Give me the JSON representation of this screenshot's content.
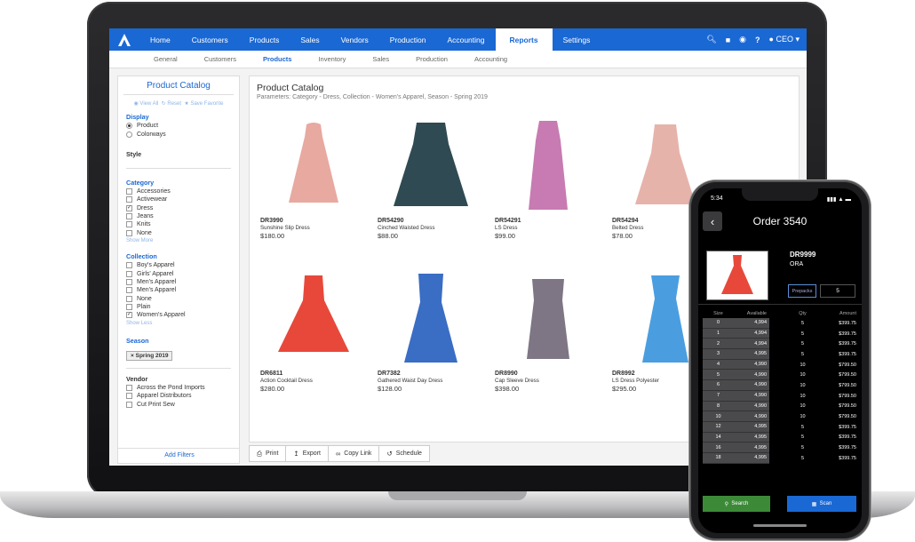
{
  "nav": {
    "items": [
      "Home",
      "Customers",
      "Products",
      "Sales",
      "Vendors",
      "Production",
      "Accounting",
      "Reports",
      "Settings"
    ],
    "active_index": 7,
    "user_label": "CEO"
  },
  "subnav": {
    "items": [
      "General",
      "Customers",
      "Products",
      "Inventory",
      "Sales",
      "Production",
      "Accounting"
    ],
    "active_index": 2
  },
  "sidebar": {
    "title": "Product Catalog",
    "actions": {
      "view_all": "View All",
      "reset": "Reset",
      "save_favorite": "Save Favorite"
    },
    "display": {
      "label": "Display",
      "options": [
        "Product",
        "Colorways"
      ],
      "selected": "Product"
    },
    "style_label": "Style",
    "category": {
      "label": "Category",
      "options": [
        "Accessories",
        "Activewear",
        "Dress",
        "Jeans",
        "Knits",
        "None"
      ],
      "checked": [
        "Dress"
      ],
      "show_link": "Show More"
    },
    "collection": {
      "label": "Collection",
      "options": [
        "Boy's Apparel",
        "Girls' Apparel",
        "Men's Apparel",
        "Men's Apparel",
        "None",
        "Plain",
        "Women's Apparel"
      ],
      "checked": [
        "Women's Apparel"
      ],
      "show_link": "Show Less"
    },
    "season": {
      "label": "Season",
      "tag": "Spring 2019"
    },
    "vendor": {
      "label": "Vendor",
      "options": [
        "Across the Pond Imports",
        "Apparel Distributors",
        "Cut Print Sew"
      ]
    },
    "add_filters": "Add Filters"
  },
  "main": {
    "title": "Product Catalog",
    "params": "Parameters: Category - Dress, Collection - Women's Apparel, Season - Spring 2019",
    "products": [
      {
        "sku": "DR3990",
        "name": "Sunshine Slip Dress",
        "price": "$180.00",
        "color": "#e8a9a0"
      },
      {
        "sku": "DR54290",
        "name": "Cinched Waisted Dress",
        "price": "$88.00",
        "color": "#2f4a52"
      },
      {
        "sku": "DR54291",
        "name": "LS Dress",
        "price": "$99.00",
        "color": "#c77bb2"
      },
      {
        "sku": "DR54294",
        "name": "Belted Dress",
        "price": "$78.00",
        "color": "#e6b3aa"
      },
      {
        "sku": "DR6811",
        "name": "Action Cocktail Dress",
        "price": "$280.00",
        "color": "#e8483a"
      },
      {
        "sku": "DR7382",
        "name": "Gathered Waist Day Dress",
        "price": "$128.00",
        "color": "#3a6dc4"
      },
      {
        "sku": "DR8990",
        "name": "Cap Sleeve Dress",
        "price": "$398.00",
        "color": "#7e7684"
      },
      {
        "sku": "DR8992",
        "name": "LS Dress Polyester",
        "price": "$295.00",
        "color": "#4a9ee0"
      }
    ]
  },
  "toolbar": {
    "print": "Print",
    "export": "Export",
    "copy_link": "Copy Link",
    "schedule": "Schedule"
  },
  "phone": {
    "time": "5:34",
    "title": "Order 3540",
    "sku": "DR9999",
    "color_code": "ORA",
    "prepacks_label": "Prepacks",
    "prepacks_value": "5",
    "left_headers": [
      "Size",
      "Available"
    ],
    "right_headers": [
      "Qty",
      "Amount"
    ],
    "rows": [
      {
        "size": "0",
        "avail": "4,994",
        "qty": "5",
        "amount": "$399.75"
      },
      {
        "size": "1",
        "avail": "4,994",
        "qty": "5",
        "amount": "$399.75"
      },
      {
        "size": "2",
        "avail": "4,994",
        "qty": "5",
        "amount": "$399.75"
      },
      {
        "size": "3",
        "avail": "4,995",
        "qty": "5",
        "amount": "$399.75"
      },
      {
        "size": "4",
        "avail": "4,990",
        "qty": "10",
        "amount": "$799.50"
      },
      {
        "size": "5",
        "avail": "4,990",
        "qty": "10",
        "amount": "$799.50"
      },
      {
        "size": "6",
        "avail": "4,990",
        "qty": "10",
        "amount": "$799.50"
      },
      {
        "size": "7",
        "avail": "4,990",
        "qty": "10",
        "amount": "$799.50"
      },
      {
        "size": "8",
        "avail": "4,990",
        "qty": "10",
        "amount": "$799.50"
      },
      {
        "size": "10",
        "avail": "4,990",
        "qty": "10",
        "amount": "$799.50"
      },
      {
        "size": "12",
        "avail": "4,995",
        "qty": "5",
        "amount": "$399.75"
      },
      {
        "size": "14",
        "avail": "4,995",
        "qty": "5",
        "amount": "$399.75"
      },
      {
        "size": "16",
        "avail": "4,995",
        "qty": "5",
        "amount": "$399.75"
      },
      {
        "size": "18",
        "avail": "4,995",
        "qty": "5",
        "amount": "$399.75"
      }
    ],
    "search_label": "Search",
    "scan_label": "Scan"
  }
}
